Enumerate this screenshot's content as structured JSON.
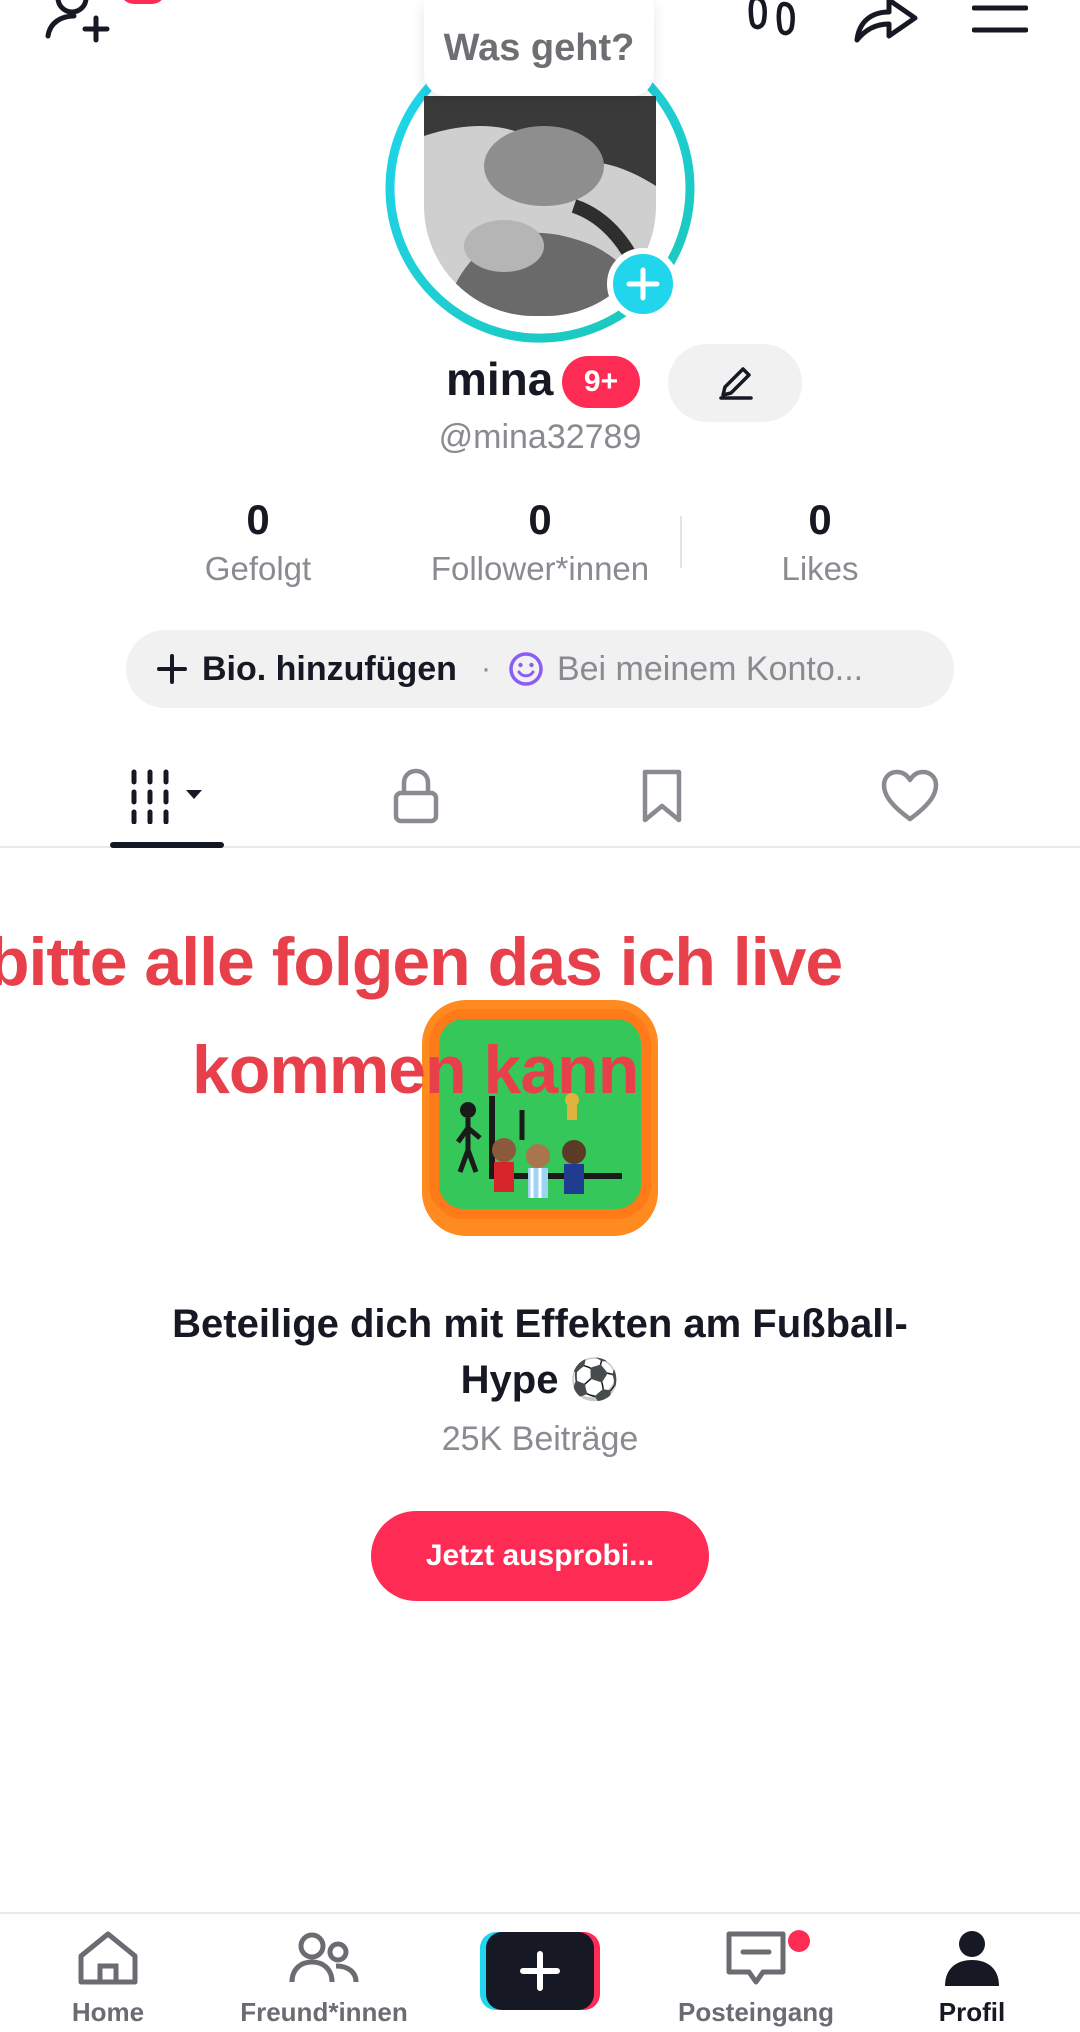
{
  "status": {
    "bubble_text": "Was geht?"
  },
  "profile": {
    "name": "mina",
    "badge": "9+",
    "handle": "@mina32789"
  },
  "stats": [
    {
      "value": "0",
      "label": "Gefolgt"
    },
    {
      "value": "0",
      "label": "Follower*innen"
    },
    {
      "value": "0",
      "label": "Likes"
    }
  ],
  "bio": {
    "add_label": "Bio. hinzufügen",
    "separator": "·",
    "account_label": "Bei meinem Konto..."
  },
  "overlay": {
    "line1": "bitte alle folgen das ich live",
    "line2": "kommen kann"
  },
  "promo": {
    "title": "Beteilige dich mit Effekten am Fußball-Hype ⚽",
    "count": "25K Beiträge",
    "button": "Jetzt ausprobi..."
  },
  "nav": {
    "items": [
      {
        "label": "Home",
        "icon": "home-icon"
      },
      {
        "label": "Freund*innen",
        "icon": "friends-icon"
      },
      {
        "label": "",
        "icon": "create-icon"
      },
      {
        "label": "Posteingang",
        "icon": "inbox-icon"
      },
      {
        "label": "Profil",
        "icon": "profile-icon"
      }
    ]
  },
  "colors": {
    "accent": "#fe2c55",
    "ring": "#20d5ec",
    "overlay_text": "#e8404a"
  }
}
